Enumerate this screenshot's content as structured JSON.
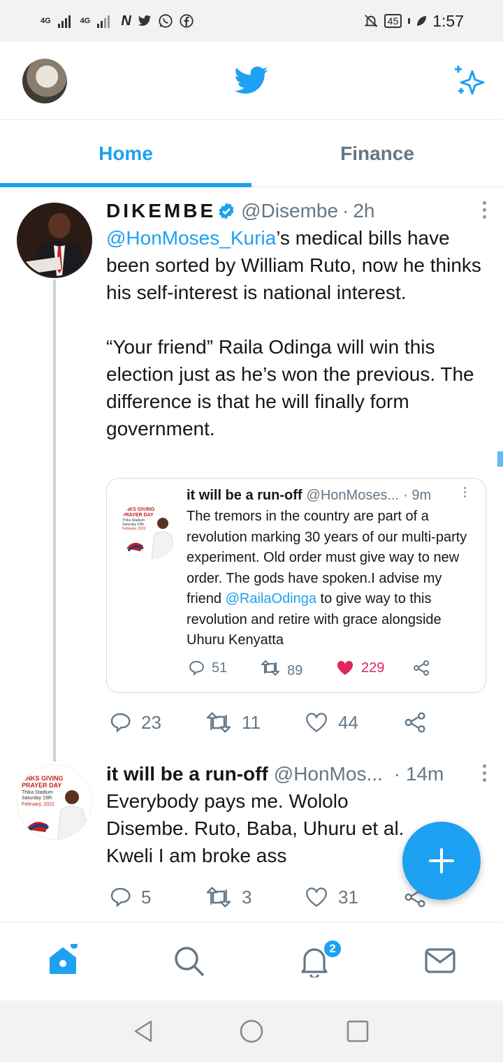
{
  "status_bar": {
    "network_1": "4G",
    "network_2": "4G",
    "battery": "45",
    "time": "1:57"
  },
  "header": {
    "logo": "twitter-bird-icon",
    "right_icon": "sparkle-icon"
  },
  "tabs": [
    {
      "label": "Home",
      "active": true
    },
    {
      "label": "Finance",
      "active": false
    }
  ],
  "tweet1": {
    "name": "DIKEMBE",
    "handle": "@Disembe",
    "dot": "·",
    "time": "2h",
    "mention": "@HonMoses_Kuria",
    "text_after_mention": "’s medical bills have been sorted by William Ruto, now he thinks his self-interest is national interest.",
    "paragraph2": "“Your friend” Raila Odinga will win this election just as he’s won the previous. The difference is that he will finally form government.",
    "quoted": {
      "name": "it will be a run-off",
      "handle": "@HonMoses...",
      "time": "· 9m",
      "text_before": "The tremors in  the country are part of  a revolution marking 30 years of our multi-party experiment. Old order must give way to new order. The gods have spoken.I advise my friend ",
      "mention": "@RailaOdinga",
      "text_after": " to give way to this revolution and retire with grace alongside Uhuru Kenyatta",
      "replies": "51",
      "retweets": "89",
      "likes": "229",
      "liked": true
    },
    "replies": "23",
    "retweets": "11",
    "likes": "44"
  },
  "tweet2": {
    "name": "it will be a run-off",
    "handle": "@HonMos...",
    "time": "· 14m",
    "text": "Everybody pays me. Wololo Disembe. Ruto, Baba, Uhuru et al.  Kweli I am broke ass",
    "avatar_text": {
      "line1": "ANKS GIVING",
      "line2": "PRAYER DAY",
      "line3": "Thika Stadium",
      "line4": "Saturday 19th",
      "line5": "February, 2022"
    },
    "replies": "5",
    "retweets": "3",
    "likes": "31"
  },
  "bottom_nav": {
    "items": [
      "home-icon",
      "search-icon",
      "notifications-icon",
      "messages-icon"
    ],
    "notification_count": "2"
  },
  "colors": {
    "accent": "#1da1f2",
    "like": "#e0245e",
    "muted": "#657786"
  }
}
